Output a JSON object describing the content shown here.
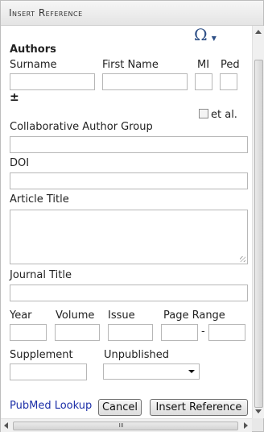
{
  "window": {
    "title": "Insert Reference"
  },
  "toolbar": {
    "special_char_icon": "Ω",
    "special_char_icon_name": "omega-icon"
  },
  "authors": {
    "heading": "Authors",
    "columns": {
      "surname": "Surname",
      "first_name": "First Name",
      "mi": "MI",
      "ped": "Ped"
    },
    "add_remove_icon": "±",
    "et_al_label": "et al.",
    "et_al_checked": false
  },
  "fields": {
    "collaborative_author_group": {
      "label": "Collaborative Author Group",
      "value": ""
    },
    "doi": {
      "label": "DOI",
      "value": ""
    },
    "article_title": {
      "label": "Article Title",
      "value": ""
    },
    "journal_title": {
      "label": "Journal Title",
      "value": ""
    },
    "year": {
      "label": "Year",
      "value": ""
    },
    "volume": {
      "label": "Volume",
      "value": ""
    },
    "issue": {
      "label": "Issue",
      "value": ""
    },
    "page_range": {
      "label": "Page Range",
      "separator": "-",
      "start": "",
      "end": ""
    },
    "supplement": {
      "label": "Supplement",
      "value": ""
    },
    "unpublished": {
      "label": "Unpublished",
      "selected": ""
    }
  },
  "actions": {
    "pubmed_lookup": "PubMed Lookup",
    "cancel": "Cancel",
    "insert_reference": "Insert Reference"
  },
  "colors": {
    "link": "#1c2fa8",
    "omega": "#2d4f86"
  }
}
